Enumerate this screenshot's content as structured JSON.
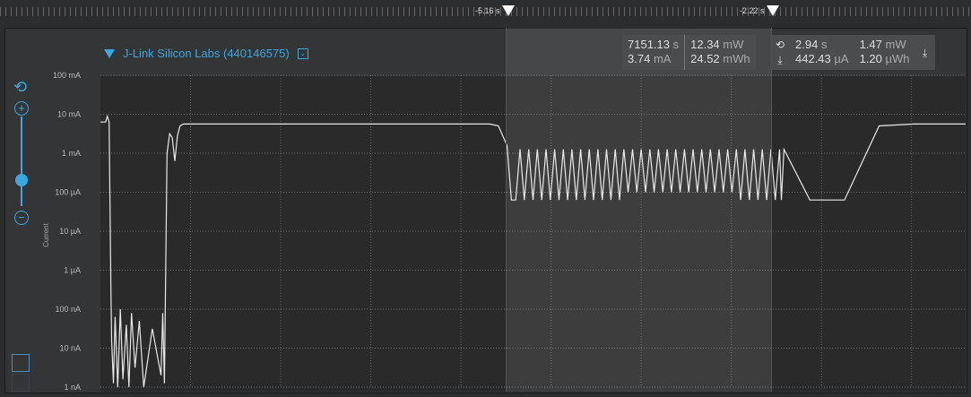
{
  "timeline": {
    "marker1_label": "-5.16 s",
    "marker2_label": "-2.22 s"
  },
  "device": {
    "name": "J-Link Silicon Labs (440146575)"
  },
  "stats_total": {
    "time": "7151.13",
    "time_unit": "s",
    "power": "12.34",
    "power_unit": "mW",
    "current": "3.74",
    "current_unit": "mA",
    "energy": "24.52",
    "energy_unit": "mWh"
  },
  "stats_selection": {
    "time": "2.94",
    "time_unit": "s",
    "power": "1.47",
    "power_unit": "mW",
    "current": "442.43",
    "current_unit": "µA",
    "energy": "1.20",
    "energy_unit": "µWh"
  },
  "colors": {
    "accent": "#3aa8e0",
    "trace": "#e8e8e8",
    "plot_bg": "#2a2a2b"
  },
  "chart_data": {
    "type": "line",
    "ylabel": "Current",
    "yscale": "log",
    "yticks": [
      "100 mA",
      "10 mA",
      "1 mA",
      "100 µA",
      "10 µA",
      "1 µA",
      "100 nA",
      "10 nA",
      "1 nA"
    ],
    "ylim": [
      "1 nA",
      "100 mA"
    ],
    "grid": true,
    "series": [
      {
        "x": [
          0,
          0.6,
          0.8,
          1.0,
          1.2,
          1.3,
          1.5,
          1.7,
          2.0,
          2.3,
          2.6,
          3.0,
          3.3,
          3.6,
          4.0,
          4.5,
          5.0,
          6.0,
          7.0,
          7.2,
          7.4,
          7.7,
          8.0,
          8.3,
          8.6,
          8.9,
          9.2,
          9.6,
          10.0,
          11.0,
          12,
          14,
          16,
          18,
          20,
          22,
          24,
          26,
          28,
          30,
          32,
          34,
          36,
          38,
          40,
          42,
          44,
          45,
          46,
          47,
          47.5,
          48,
          48.5,
          49,
          49.5,
          50,
          50.5,
          51,
          51.5,
          52,
          52.5,
          53,
          53.5,
          54,
          54.5,
          55,
          55.5,
          56,
          56.5,
          57,
          57.5,
          58,
          58.5,
          59,
          59.5,
          60,
          60.5,
          61,
          61.5,
          62,
          62.5,
          63,
          63.5,
          64,
          64.5,
          65,
          65.5,
          66,
          66.5,
          67,
          67.5,
          68,
          68.5,
          69,
          69.5,
          70,
          70.5,
          71,
          71.5,
          72,
          72.5,
          73,
          73.5,
          74,
          74.5,
          75,
          75.5,
          76,
          76.5,
          77,
          77.5,
          78,
          78.5,
          78.7,
          79,
          82,
          86,
          90,
          94,
          98,
          100
        ],
        "y_log10_A": [
          -2.2,
          -2.2,
          -2.05,
          -2.2,
          -6.3,
          -7.8,
          -8.9,
          -7.2,
          -9,
          -7,
          -8.8,
          -7.4,
          -9,
          -7.1,
          -8.5,
          -7.3,
          -9,
          -7.5,
          -8.7,
          -7.1,
          -8.9,
          -3,
          -2.5,
          -2.6,
          -3.2,
          -2.55,
          -2.3,
          -2.25,
          -2.25,
          -2.25,
          -2.25,
          -2.25,
          -2.25,
          -2.25,
          -2.25,
          -2.25,
          -2.25,
          -2.25,
          -2.25,
          -2.25,
          -2.25,
          -2.25,
          -2.25,
          -2.25,
          -2.25,
          -2.25,
          -2.25,
          -2.25,
          -2.3,
          -2.8,
          -4.2,
          -4.2,
          -2.9,
          -4.2,
          -2.9,
          -4.2,
          -2.9,
          -4.2,
          -2.9,
          -4.2,
          -2.9,
          -4.2,
          -2.9,
          -4.2,
          -2.9,
          -4.2,
          -2.9,
          -4.2,
          -2.9,
          -4.2,
          -2.9,
          -4.2,
          -2.9,
          -4.2,
          -2.9,
          -4.2,
          -2.9,
          -4.0,
          -2.9,
          -4.0,
          -2.9,
          -4.0,
          -2.9,
          -4.0,
          -2.9,
          -4.0,
          -2.9,
          -4.0,
          -2.9,
          -4.0,
          -2.9,
          -4.0,
          -2.9,
          -4.0,
          -2.9,
          -4.0,
          -2.9,
          -4.0,
          -2.9,
          -4.0,
          -2.9,
          -4.0,
          -2.9,
          -4.2,
          -2.9,
          -4.2,
          -2.9,
          -4.2,
          -2.9,
          -4.2,
          -2.9,
          -4.2,
          -2.9,
          -4.2,
          -2.9,
          -4.2,
          -4.2,
          -2.3,
          -2.25,
          -2.25,
          -2.25,
          -2.25,
          -2.25,
          -2.25
        ]
      }
    ]
  }
}
